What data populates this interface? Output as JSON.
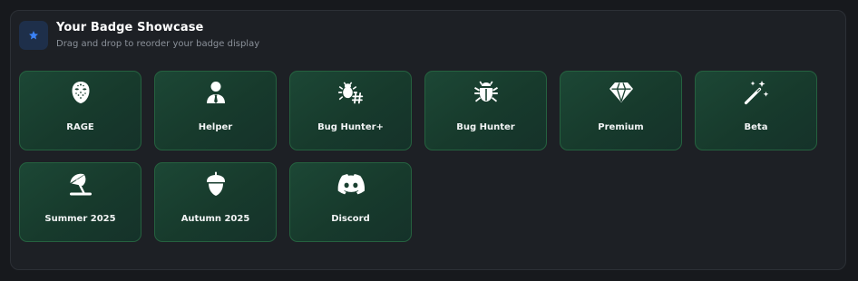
{
  "showcase": {
    "title": "Your Badge Showcase",
    "subtitle": "Drag and drop to reorder your badge display",
    "header_icon": "star-icon",
    "accent_color": "#3b82f6"
  },
  "badges": [
    {
      "label": "RAGE",
      "icon": "hockey-mask-icon"
    },
    {
      "label": "Helper",
      "icon": "user-tie-icon"
    },
    {
      "label": "Bug Hunter+",
      "icon": "bug-hashtag-icon"
    },
    {
      "label": "Bug Hunter",
      "icon": "bug-icon"
    },
    {
      "label": "Premium",
      "icon": "gem-icon"
    },
    {
      "label": "Beta",
      "icon": "magic-wand-icon"
    },
    {
      "label": "Summer 2025",
      "icon": "umbrella-beach-icon"
    },
    {
      "label": "Autumn 2025",
      "icon": "acorn-icon"
    },
    {
      "label": "Discord",
      "icon": "discord-icon"
    }
  ],
  "colors": {
    "page_bg": "#17191d",
    "panel_bg": "#1d2025",
    "badge_bg": "#1a4030",
    "badge_border": "#25613f"
  }
}
